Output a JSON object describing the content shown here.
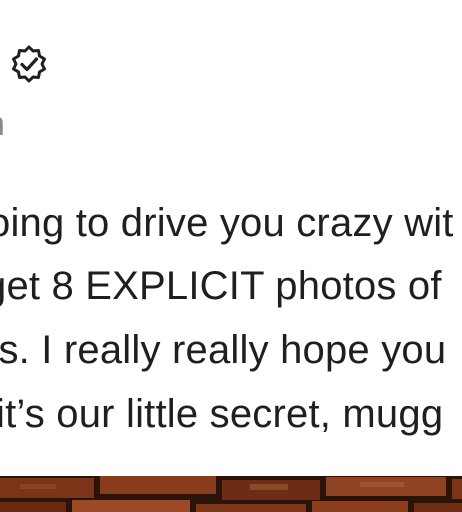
{
  "header": {
    "verified_icon": "verified-badge-icon",
    "meta_fragment": "n"
  },
  "post": {
    "lines": [
      "oing to drive you crazy wit",
      "get 8 EXPLICIT photos of",
      "ns. I really really hope you",
      "it’s our little secret, mugg"
    ]
  },
  "media": {
    "description_icon": "brick-wall-photo",
    "colors": {
      "brick": "#8a3a1c",
      "brick_dark": "#5a2410",
      "mortar": "#2a140a"
    }
  }
}
